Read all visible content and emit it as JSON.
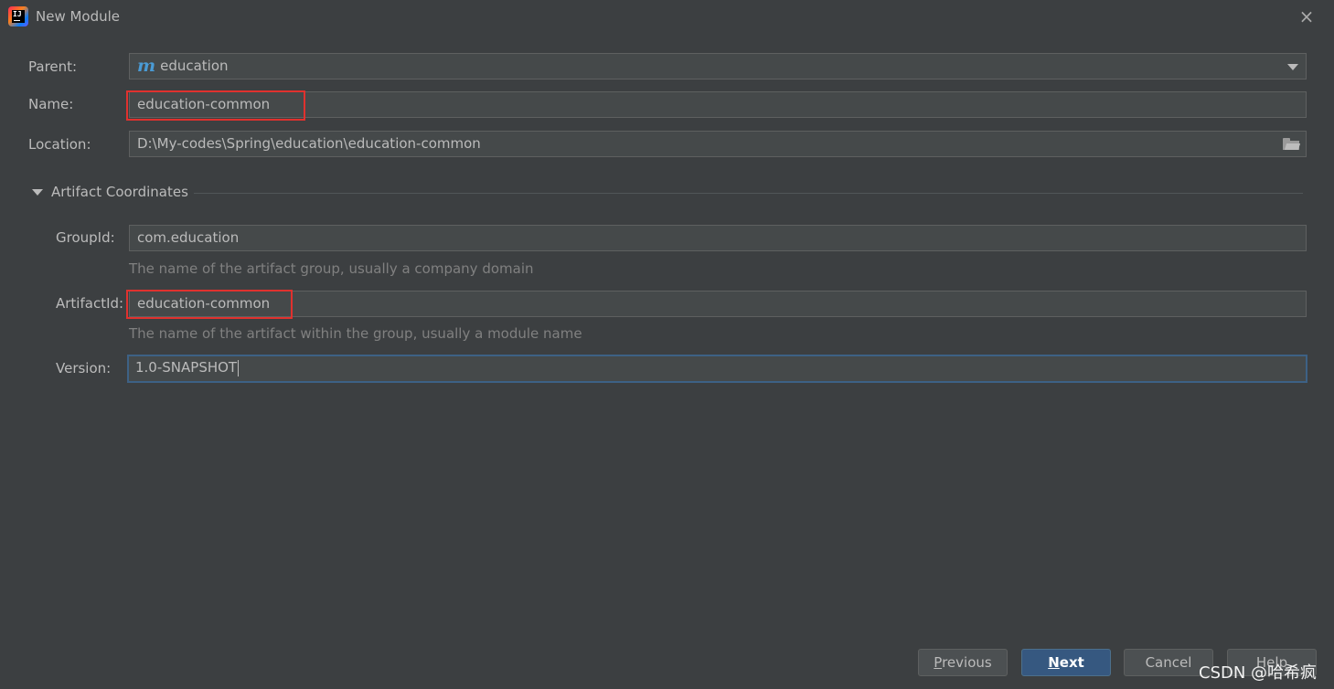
{
  "window": {
    "title": "New Module",
    "close_glyph": "×"
  },
  "form": {
    "parent": {
      "label": "Parent:",
      "value": "education",
      "icon": "maven-module-icon",
      "icon_glyph": "m"
    },
    "name": {
      "label": "Name:",
      "value": "education-common"
    },
    "location": {
      "label": "Location:",
      "value": "D:\\My-codes\\Spring\\education\\education-common"
    }
  },
  "artifact": {
    "section_title": "Artifact Coordinates",
    "group_id": {
      "label": "GroupId:",
      "value": "com.education",
      "hint": "The name of the artifact group, usually a company domain"
    },
    "artifact_id": {
      "label": "ArtifactId:",
      "value": "education-common",
      "hint": "The name of the artifact within the group, usually a module name"
    },
    "version": {
      "label": "Version:",
      "value": "1.0-SNAPSHOT"
    }
  },
  "buttons": {
    "previous": {
      "mnemonic": "P",
      "rest": "revious"
    },
    "next": {
      "mnemonic": "N",
      "rest": "ext"
    },
    "cancel": "Cancel",
    "help": "Help"
  },
  "watermark": "CSDN @哈希疯",
  "colors": {
    "background": "#3c3f41",
    "field": "#45494a",
    "focus_border": "#3d6185",
    "highlight": "#e0312e",
    "primary_button": "#365880"
  }
}
